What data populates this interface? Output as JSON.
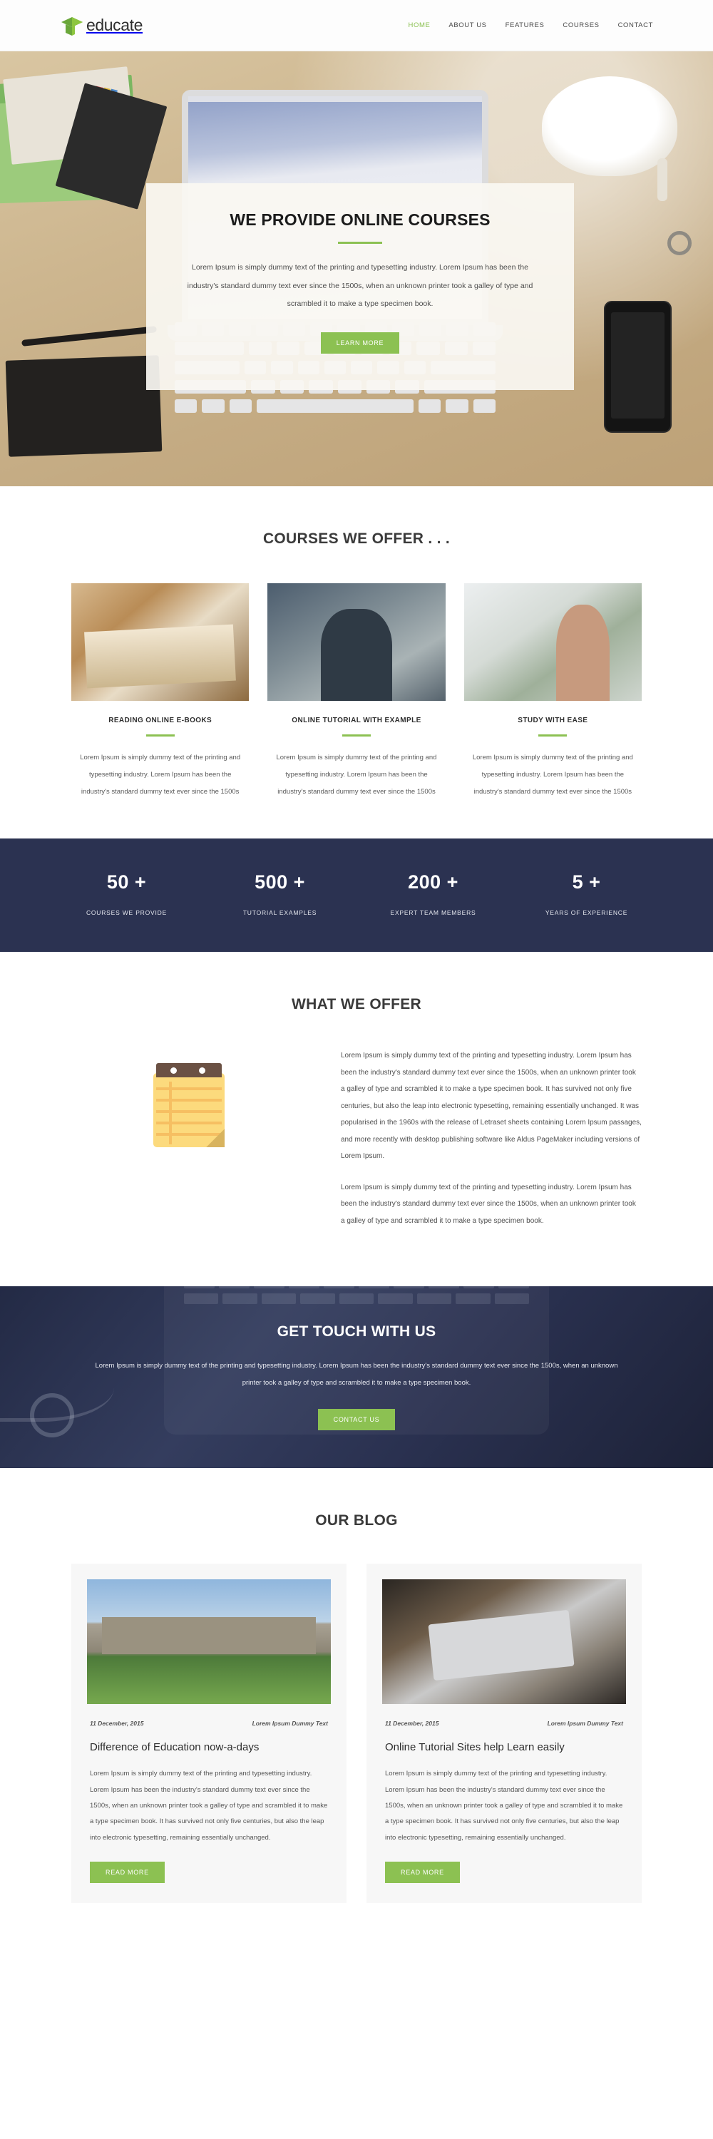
{
  "header": {
    "brand_name": "educate",
    "logo_icon": "graduation-cap-icon",
    "accent_color": "#8cc152",
    "nav": [
      {
        "label": "HOME",
        "active": true
      },
      {
        "label": "ABOUT US",
        "active": false
      },
      {
        "label": "FEATURES",
        "active": false
      },
      {
        "label": "COURSES",
        "active": false
      },
      {
        "label": "CONTACT",
        "active": false
      }
    ]
  },
  "hero": {
    "title": "WE PROVIDE ONLINE COURSES",
    "text": "Lorem Ipsum is simply dummy text of the printing and typesetting industry. Lorem Ipsum has been the industry's standard dummy text ever since the 1500s, when an unknown printer took a galley of type and scrambled it to make a type specimen book.",
    "button_label": "LEARN MORE"
  },
  "courses": {
    "title": "COURSES WE OFFER . . .",
    "items": [
      {
        "title": "READING ONLINE E-BOOKS",
        "text": "Lorem Ipsum is simply dummy text of the printing and typesetting industry. Lorem Ipsum has been the industry's standard dummy text ever since the 1500s",
        "image_name": "open-book-photo"
      },
      {
        "title": "ONLINE TUTORIAL WITH EXAMPLE",
        "text": "Lorem Ipsum is simply dummy text of the printing and typesetting industry. Lorem Ipsum has been the industry's standard dummy text ever since the 1500s",
        "image_name": "student-at-desk-photo"
      },
      {
        "title": "STUDY WITH EASE",
        "text": "Lorem Ipsum is simply dummy text of the printing and typesetting industry. Lorem Ipsum has been the industry's standard dummy text ever since the 1500s",
        "image_name": "woman-reading-photo"
      }
    ]
  },
  "stats": {
    "background_color": "#2b3251",
    "items": [
      {
        "number": "50 +",
        "label": "COURSES WE PROVIDE"
      },
      {
        "number": "500 +",
        "label": "TUTORIAL EXAMPLES"
      },
      {
        "number": "200 +",
        "label": "EXPERT TEAM MEMBERS"
      },
      {
        "number": "5 +",
        "label": "YEARS OF EXPERIENCE"
      }
    ]
  },
  "offer": {
    "title": "WHAT WE OFFER",
    "icon_name": "notepad-icon",
    "paragraphs": [
      "Lorem Ipsum is simply dummy text of the printing and typesetting industry. Lorem Ipsum has been the industry's standard dummy text ever since the 1500s, when an unknown printer took a galley of type and scrambled it to make a type specimen book. It has survived not only five centuries, but also the leap into electronic typesetting, remaining essentially unchanged. It was popularised in the 1960s with the release of Letraset sheets containing Lorem Ipsum passages, and more recently with desktop publishing software like Aldus PageMaker including versions of Lorem Ipsum.",
      "Lorem Ipsum is simply dummy text of the printing and typesetting industry. Lorem Ipsum has been the industry's standard dummy text ever since the 1500s, when an unknown printer took a galley of type and scrambled it to make a type specimen book."
    ]
  },
  "contact": {
    "title": "GET TOUCH WITH US",
    "text": "Lorem Ipsum is simply dummy text of the printing and typesetting industry. Lorem Ipsum has been the industry's standard dummy text ever since the 1500s, when an unknown printer took a galley of type and scrambled it to make a type specimen book.",
    "button_label": "CONTACT US"
  },
  "blog": {
    "title": "OUR BLOG",
    "posts": [
      {
        "date": "11 December, 2015",
        "tag": "Lorem Ipsum Dummy Text",
        "title": "Difference of Education now-a-days",
        "text": "Lorem Ipsum is simply dummy text of the printing and typesetting industry. Lorem Ipsum has been the industry's standard dummy text ever since the 1500s, when an unknown printer took a galley of type and scrambled it to make a type specimen book. It has survived not only five centuries, but also the leap into electronic typesetting, remaining essentially unchanged.",
        "button_label": "READ MORE",
        "image_name": "university-campus-photo"
      },
      {
        "date": "11 December, 2015",
        "tag": "Lorem Ipsum Dummy Text",
        "title": "Online Tutorial Sites help Learn easily",
        "text": "Lorem Ipsum is simply dummy text of the printing and typesetting industry. Lorem Ipsum has been the industry's standard dummy text ever since the 1500s, when an unknown printer took a galley of type and scrambled it to make a type specimen book. It has survived not only five centuries, but also the leap into electronic typesetting, remaining essentially unchanged.",
        "button_label": "READ MORE",
        "image_name": "laptop-on-desk-photo"
      }
    ]
  }
}
